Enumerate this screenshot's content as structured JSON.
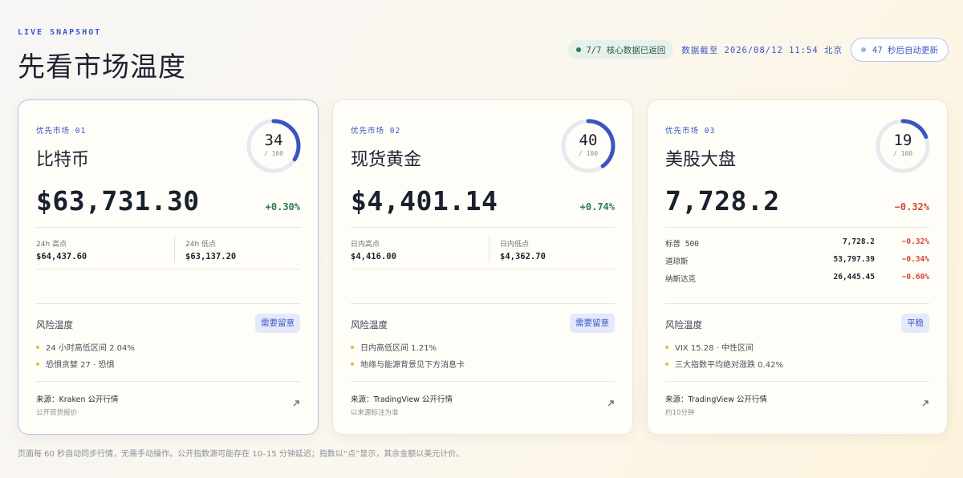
{
  "header": {
    "eyebrow": "LIVE SNAPSHOT",
    "title": "先看市场温度",
    "status_ok": "7/7 核心数据已返回",
    "data_time": "数据截至 2026/08/12 11:54 北京",
    "refresh": "47 秒后自动更新"
  },
  "cards": [
    {
      "tag": "优先市场 01",
      "name": "比特币",
      "score": "34",
      "score_max": "/ 100",
      "score_fraction": 0.34,
      "price": "$63,731.30",
      "change": "+0.30%",
      "change_dir": "up",
      "high_label": "24h 高点",
      "high_value": "$64,437.60",
      "low_label": "24h 低点",
      "low_value": "$63,137.20",
      "risk_label": "风险温度",
      "badge": "需要留意",
      "bullets": [
        "24 小时高低区间 2.04%",
        "恐惧贪婪 27 · 恐惧"
      ],
      "source": "来源：Kraken 公开行情",
      "source_sub": "公开现货报价"
    },
    {
      "tag": "优先市场 02",
      "name": "现货黄金",
      "score": "40",
      "score_max": "/ 100",
      "score_fraction": 0.4,
      "price": "$4,401.14",
      "change": "+0.74%",
      "change_dir": "up",
      "high_label": "日内高点",
      "high_value": "$4,416.00",
      "low_label": "日内低点",
      "low_value": "$4,362.70",
      "risk_label": "风险温度",
      "badge": "需要留意",
      "bullets": [
        "日内高低区间 1.21%",
        "地缘与能源背景见下方消息卡"
      ],
      "source": "来源：TradingView 公开行情",
      "source_sub": "以来源标注为准"
    },
    {
      "tag": "优先市场 03",
      "name": "美股大盘",
      "score": "19",
      "score_max": "/ 100",
      "score_fraction": 0.19,
      "price": "7,728.2",
      "change": "−0.32%",
      "change_dir": "down",
      "indices": [
        {
          "name": "标普 500",
          "value": "7,728.2",
          "change": "−0.32%"
        },
        {
          "name": "道琼斯",
          "value": "53,797.39",
          "change": "−0.34%"
        },
        {
          "name": "纳斯达克",
          "value": "26,445.45",
          "change": "−0.60%"
        }
      ],
      "risk_label": "风险温度",
      "badge": "平稳",
      "bullets": [
        "VIX 15.28 · 中性区间",
        "三大指数平均绝对涨跌 0.42%"
      ],
      "source": "来源：TradingView 公开行情",
      "source_sub": "约10分钟"
    }
  ],
  "colors": {
    "accent": "#3a55c2",
    "up": "#2e7a4f",
    "down": "#d3473a",
    "bullet": "#e9b93a"
  },
  "footnote": "页面每 60 秒自动同步行情，无需手动操作。公开指数源可能存在 10–15 分钟延迟；指数以“点”显示，其余金额以美元计价。"
}
